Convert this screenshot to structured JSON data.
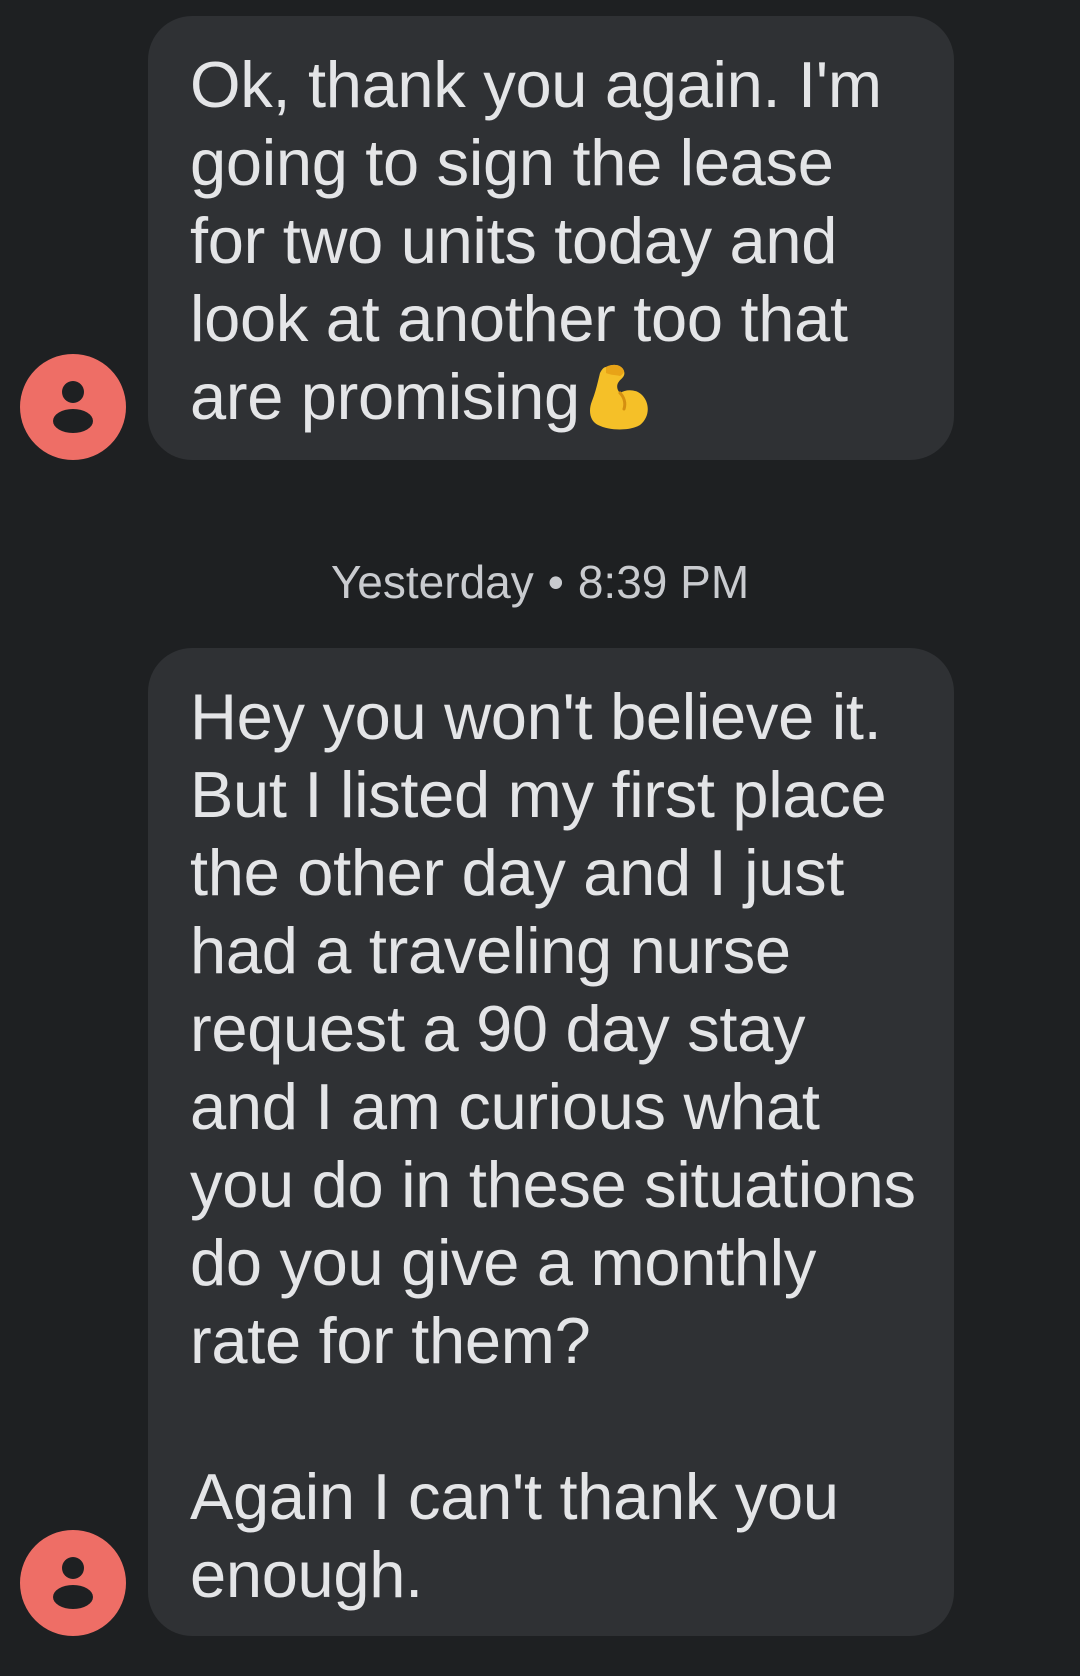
{
  "messages": [
    {
      "text": "Ok, thank you again. I'm going to sign the lease for two units today and look at another too that are promising",
      "emoji": "flexed-biceps-icon"
    },
    {
      "text": "Hey you won't believe it. But I listed my first place the other day and I just had a traveling nurse request a 90 day stay and I am curious what you do in these situations do you give a monthly rate for them?\n\nAgain I can't thank you enough."
    }
  ],
  "timestamp": {
    "day": "Yesterday",
    "separator": "•",
    "time": "8:39 PM"
  },
  "colors": {
    "background": "#1e2022",
    "bubble": "#2f3134",
    "avatar": "#ee6e66",
    "text": "#e4e5e7"
  }
}
